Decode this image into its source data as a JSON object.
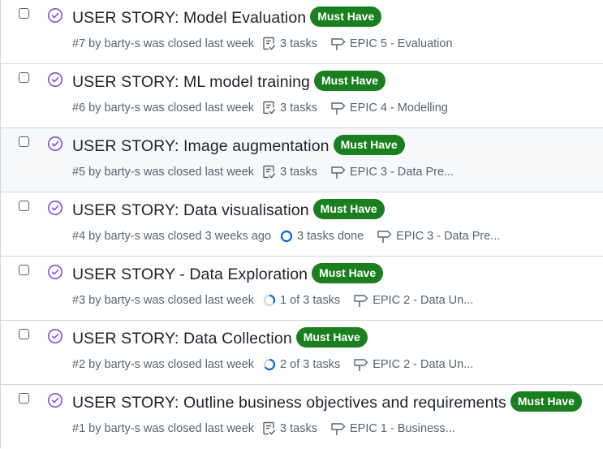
{
  "issues": [
    {
      "title": "USER STORY: Model Evaluation",
      "label": "Must Have",
      "meta": "#7 by barty-s was closed last week",
      "tasks_icon": "checklist-icon",
      "tasks": "3 tasks",
      "milestone": "EPIC 5 - Evaluation"
    },
    {
      "title": "USER STORY: ML model training",
      "label": "Must Have",
      "meta": "#6 by barty-s was closed last week",
      "tasks_icon": "checklist-icon",
      "tasks": "3 tasks",
      "milestone": "EPIC 4 - Modelling"
    },
    {
      "title": "USER STORY: Image augmentation",
      "label": "Must Have",
      "meta": "#5 by barty-s was closed last week",
      "tasks_icon": "checklist-icon",
      "tasks": "3 tasks",
      "milestone": "EPIC 3 - Data Pre..."
    },
    {
      "title": "USER STORY: Data visualisation",
      "label": "Must Have",
      "meta": "#4 by barty-s was closed 3 weeks ago",
      "tasks_icon": "progress-circle-full-icon",
      "tasks": "3 tasks done",
      "milestone": "EPIC 3 - Data Pre..."
    },
    {
      "title": "USER STORY - Data Exploration",
      "label": "Must Have",
      "meta": "#3 by barty-s was closed last week",
      "tasks_icon": "progress-circle-third-icon",
      "tasks": "1 of 3 tasks",
      "milestone": "EPIC 2 - Data Un..."
    },
    {
      "title": "USER STORY: Data Collection",
      "label": "Must Have",
      "meta": "#2 by barty-s was closed last week",
      "tasks_icon": "progress-circle-two-thirds-icon",
      "tasks": "2 of 3 tasks",
      "milestone": "EPIC 2 - Data Un..."
    },
    {
      "title": "USER STORY: Outline business objectives and requirements",
      "label": "Must Have",
      "meta": "#1 by barty-s was closed last week",
      "tasks_icon": "checklist-icon",
      "tasks": "3 tasks",
      "milestone": "EPIC 1 - Business..."
    }
  ],
  "colors": {
    "label_bg": "#1a7f1f",
    "closed_icon": "#8250df",
    "progress": "#0969da",
    "meta_text": "#59636e"
  }
}
